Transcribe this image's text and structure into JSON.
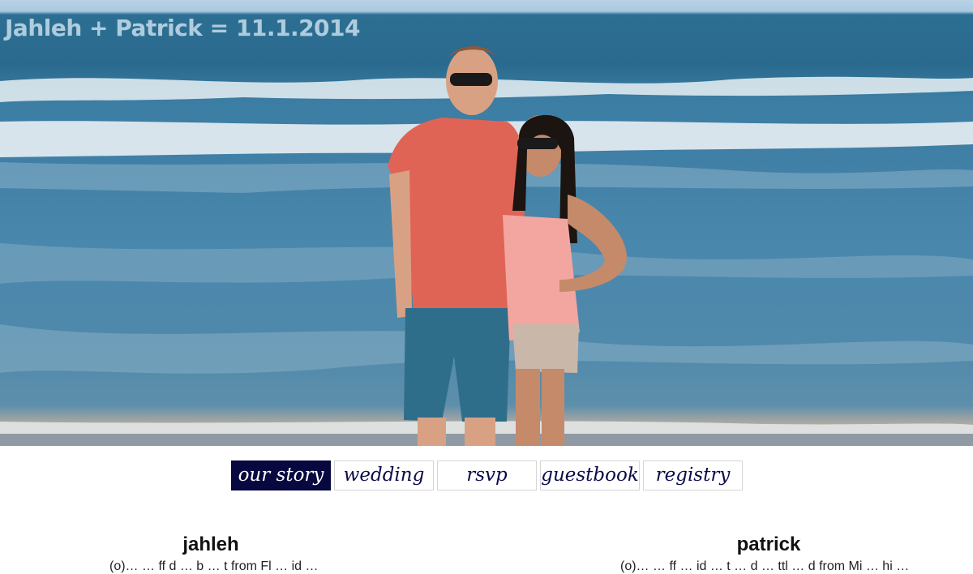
{
  "site": {
    "title": "Jahleh + Patrick = 11.1.2014"
  },
  "hero": {
    "image_subject": "couple-on-beach-photo"
  },
  "nav": {
    "tabs": [
      {
        "label": "our story",
        "active": true
      },
      {
        "label": "wedding",
        "active": false
      },
      {
        "label": "rsvp",
        "active": false
      },
      {
        "label": "guestbook",
        "active": false
      },
      {
        "label": "registry",
        "active": false
      }
    ]
  },
  "bios": {
    "left": {
      "name": "jahleh",
      "text": "(o)… … ff d … b … t from Fl … id …"
    },
    "right": {
      "name": "patrick",
      "text": "(o)… … ff … id … t … d … ttl … d from Mi … hi …"
    }
  },
  "colors": {
    "nav_active_bg": "#07083f",
    "nav_text": "#0b0b4a",
    "title_overlay": "#cde1ee"
  }
}
